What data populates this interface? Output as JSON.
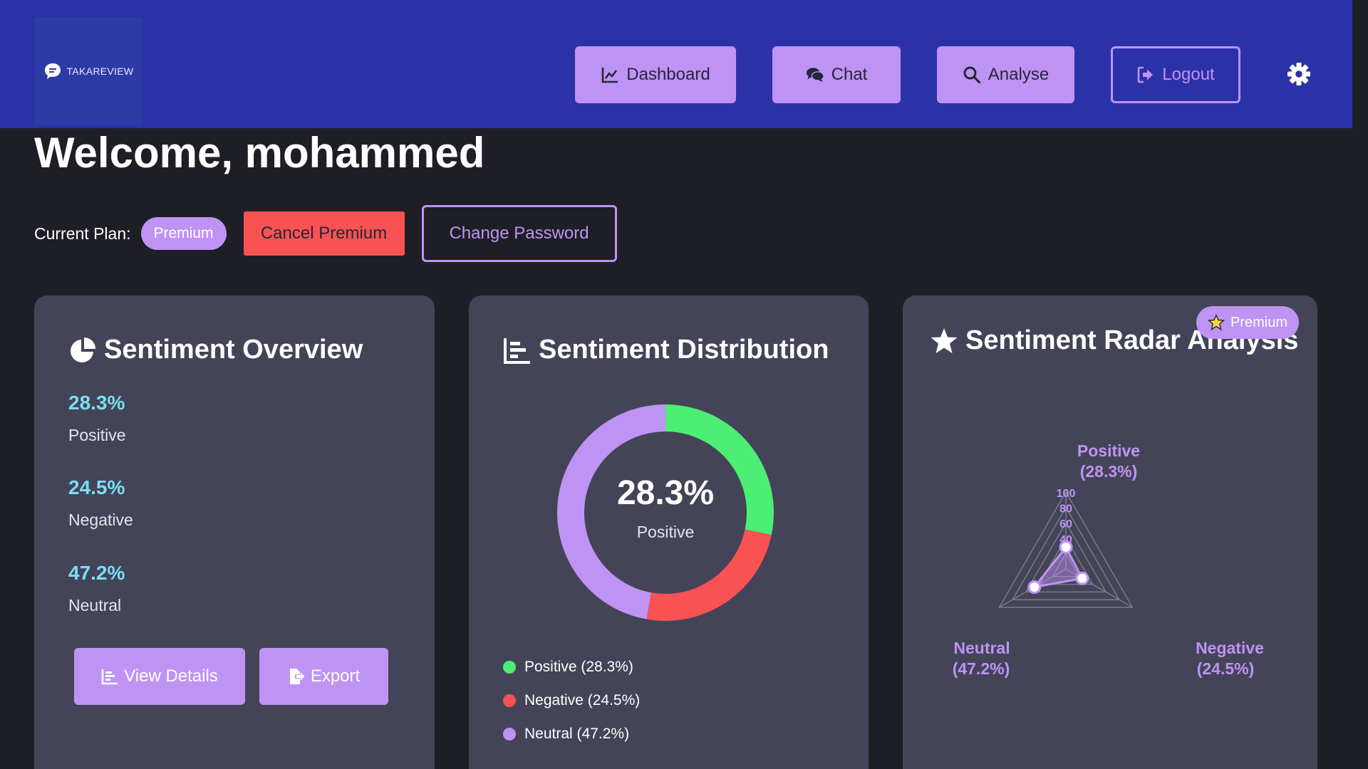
{
  "header": {
    "logo_text": "TAKAREVIEW",
    "nav": {
      "dashboard": "Dashboard",
      "chat": "Chat",
      "analyse": "Analyse",
      "logout": "Logout"
    }
  },
  "welcome": {
    "title": "Welcome, mohammed",
    "plan_label": "Current Plan:",
    "plan_badge": "Premium",
    "cancel_button": "Cancel Premium",
    "change_password_button": "Change Password"
  },
  "overview": {
    "title": "Sentiment Overview",
    "stats": [
      {
        "value": "28.3%",
        "label": "Positive"
      },
      {
        "value": "24.5%",
        "label": "Negative"
      },
      {
        "value": "47.2%",
        "label": "Neutral"
      }
    ],
    "view_details_button": "View Details",
    "export_button": "Export"
  },
  "distribution": {
    "title": "Sentiment Distribution",
    "center_value": "28.3%",
    "center_label": "Positive",
    "legend": [
      {
        "label": "Positive (28.3%)",
        "color": "#4cef73"
      },
      {
        "label": "Negative (24.5%)",
        "color": "#f85252"
      },
      {
        "label": "Neutral (47.2%)",
        "color": "#bf93f4"
      }
    ]
  },
  "radar": {
    "title": "Sentiment Radar Analysis",
    "premium_tag": "Premium",
    "labels": {
      "positive_line1": "Positive",
      "positive_line2": "(28.3%)",
      "negative_line1": "Negative",
      "negative_line2": "(24.5%)",
      "neutral_line1": "Neutral",
      "neutral_line2": "(47.2%)"
    },
    "ticks": [
      "100",
      "80",
      "60",
      "40"
    ]
  },
  "chart_data": [
    {
      "type": "pie",
      "title": "Sentiment Distribution",
      "categories": [
        "Positive",
        "Negative",
        "Neutral"
      ],
      "values": [
        28.3,
        24.5,
        47.2
      ],
      "colors": [
        "#4cef73",
        "#f85252",
        "#bf93f4"
      ],
      "donut": true
    },
    {
      "type": "radar",
      "title": "Sentiment Radar Analysis",
      "categories": [
        "Positive",
        "Negative",
        "Neutral"
      ],
      "values": [
        28.3,
        24.5,
        47.2
      ],
      "range": [
        0,
        100
      ],
      "ticks": [
        20,
        40,
        60,
        80,
        100
      ]
    }
  ],
  "colors": {
    "header_bg": "#2b32a8",
    "page_bg": "#1e1e26",
    "card_bg": "#444458",
    "accent": "#bf93f4",
    "danger": "#f85252",
    "stat_value": "#79def4"
  }
}
